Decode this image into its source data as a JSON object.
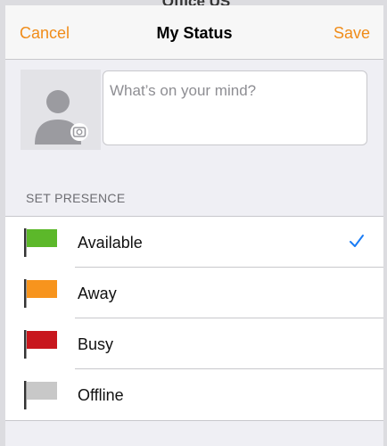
{
  "background": {
    "partial_title": "Office US"
  },
  "navbar": {
    "cancel_label": "Cancel",
    "title": "My Status",
    "save_label": "Save"
  },
  "status": {
    "placeholder": "What’s on your mind?"
  },
  "presence": {
    "header": "SET PRESENCE",
    "selected": "Available",
    "options": [
      {
        "label": "Available",
        "flag_color": "#5cb82a",
        "selected": true
      },
      {
        "label": "Away",
        "flag_color": "#f7941d",
        "selected": false
      },
      {
        "label": "Busy",
        "flag_color": "#c8161d",
        "selected": false
      },
      {
        "label": "Offline",
        "flag_color": "#c8c8c8",
        "selected": false
      }
    ]
  },
  "colors": {
    "accent": "#f08c19",
    "checkmark": "#1a7cf5"
  },
  "icons": {
    "avatar": "person-camera-icon",
    "checkmark": "checkmark-icon",
    "flag": "flag-icon"
  }
}
